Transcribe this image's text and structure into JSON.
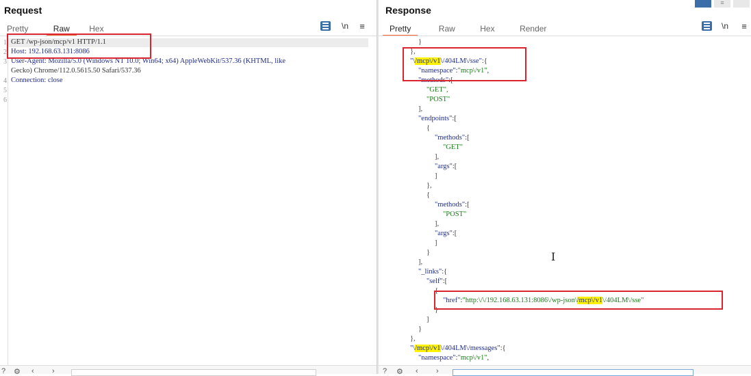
{
  "request": {
    "title": "Request",
    "tabs": [
      "Pretty",
      "Raw",
      "Hex"
    ],
    "active_tab": "Raw",
    "toggle_newline": "\\n",
    "line_numbers": [
      "1",
      "2",
      "3",
      "4",
      "5",
      "6"
    ],
    "lines": [
      "GET /wp-json/mcp/v1 HTTP/1.1",
      "Host: 192.168.63.131:8086",
      "User-Agent: Mozilla/5.0 (Windows NT 10.0; Win64; x64) AppleWebKit/537.36 (KHTML, like",
      "Gecko) Chrome/112.0.5615.50 Safari/537.36",
      "Connection: close"
    ]
  },
  "response": {
    "title": "Response",
    "tabs": [
      "Pretty",
      "Raw",
      "Hex",
      "Render"
    ],
    "active_tab": "Pretty",
    "toggle_newline": "\\n"
  },
  "colors": {
    "accent": "#ff6633",
    "highlight": "#fff200",
    "redbox": "#d9242f",
    "key": "#1f2c8a",
    "string": "#1a7a1a"
  }
}
